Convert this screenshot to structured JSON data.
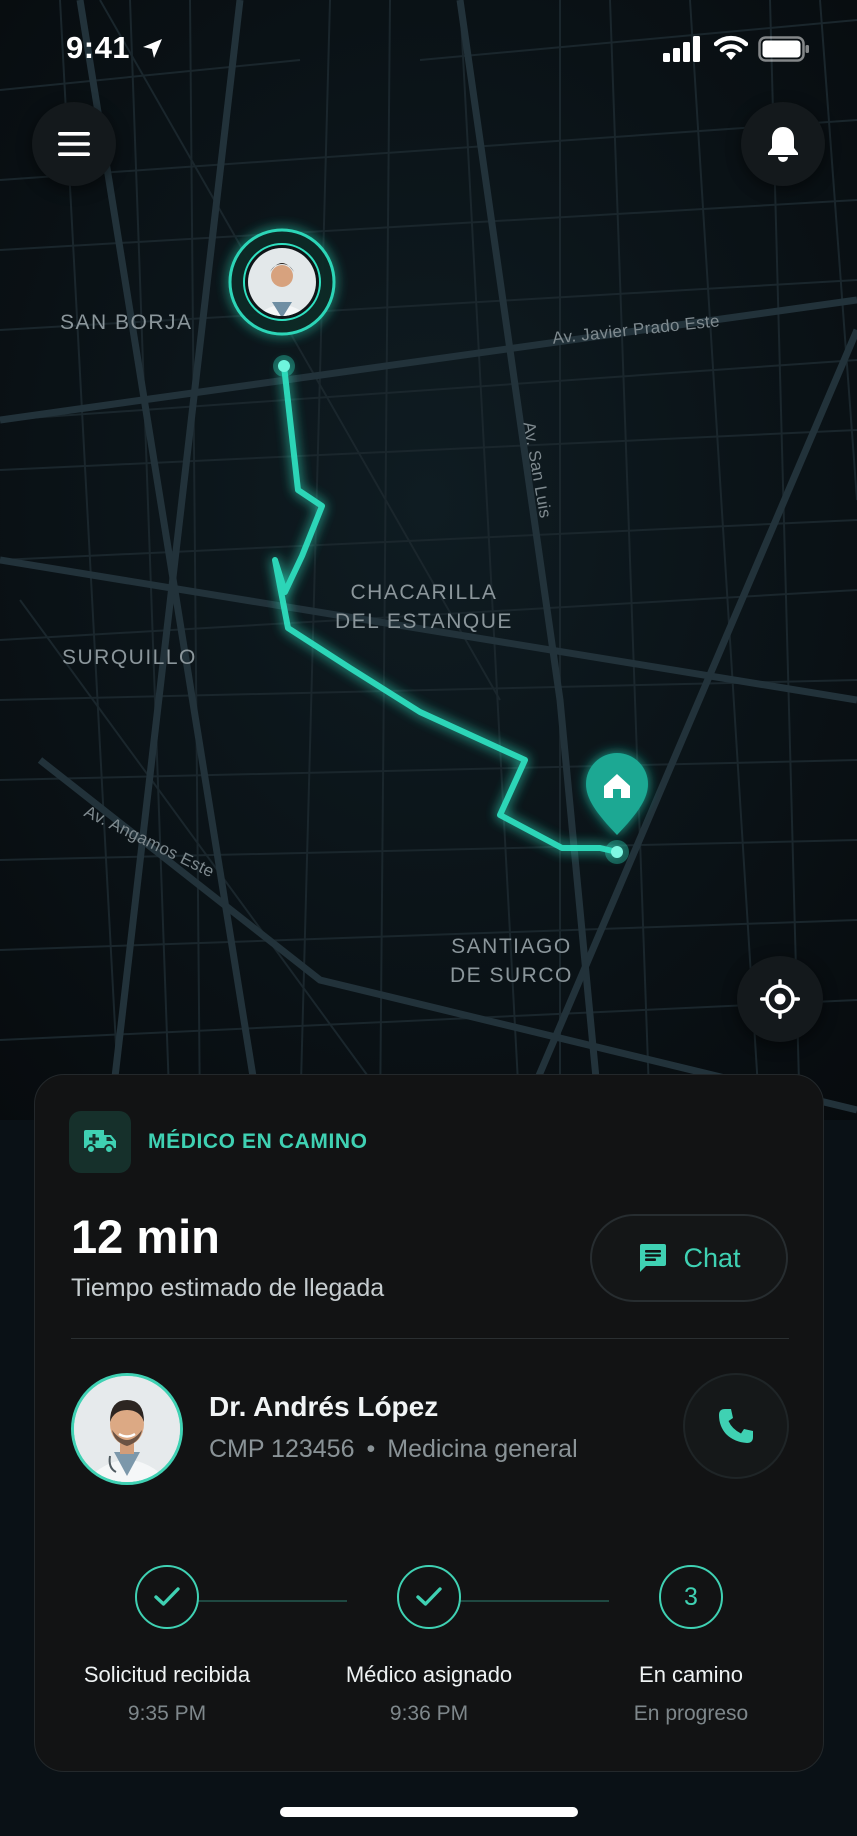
{
  "status_bar": {
    "time": "9:41"
  },
  "map": {
    "districts": {
      "san_borja": "SAN BORJA",
      "chacarilla": "CHACARILLA\nDEL ESTANQUE",
      "surquillo": "SURQUILLO",
      "santiago_de_surco": "SANTIAGO\nDE SURCO"
    },
    "streets": {
      "javier_prado": "Av. Javier Prado Este",
      "san_luis": "Av. San Luis",
      "angamos": "Av. Angamos Este"
    },
    "route_color": "#2fe0c0"
  },
  "card": {
    "status_label": "MÉDICO EN CAMINO",
    "eta_value": "12 min",
    "eta_caption": "Tiempo estimado de llegada",
    "chat_label": "Chat",
    "doctor": {
      "name": "Dr. Andrés López",
      "cmp": "CMP 123456",
      "separator": "•",
      "specialty": "Medicina general"
    },
    "steps": [
      {
        "title": "Solicitud recibida",
        "subtitle": "9:35 PM",
        "state": "done"
      },
      {
        "title": "Médico asignado",
        "subtitle": "9:36 PM",
        "state": "done"
      },
      {
        "title": "En camino",
        "subtitle": "En progreso",
        "state": "current",
        "number": "3"
      }
    ]
  },
  "colors": {
    "accent": "#3fd1b3",
    "card_background": "#121314",
    "map_background": "#0a1116"
  },
  "icons": [
    "menu-icon",
    "bell-icon",
    "locate-icon",
    "ambulance-icon",
    "chat-icon",
    "phone-icon",
    "check-icon",
    "home-icon",
    "location-arrow-icon",
    "signal-icon",
    "wifi-icon",
    "battery-icon"
  ]
}
